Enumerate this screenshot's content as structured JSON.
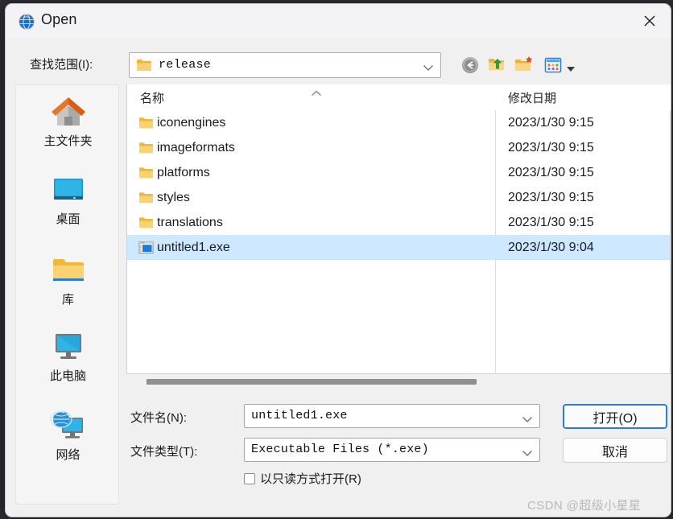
{
  "window": {
    "title": "Open",
    "icon": "qt-globe-icon",
    "close_label": "✕"
  },
  "lookin": {
    "label": "查找范围(I):",
    "value": "release",
    "icon": "folder-icon"
  },
  "toolbar": {
    "back": "back-icon",
    "parent": "parent-folder-icon",
    "new_folder": "new-folder-icon",
    "view_mode": "view-mode-icon",
    "view_arrow": "chevron-down-icon"
  },
  "sidebar": {
    "items": [
      {
        "label": "主文件夹",
        "icon": "home-icon"
      },
      {
        "label": "桌面",
        "icon": "desktop-icon"
      },
      {
        "label": "库",
        "icon": "library-folder-icon"
      },
      {
        "label": "此电脑",
        "icon": "this-pc-icon"
      },
      {
        "label": "网络",
        "icon": "network-icon"
      }
    ]
  },
  "filelist": {
    "columns": [
      "名称",
      "修改日期"
    ],
    "sort_indicator": "sort-ascending-icon",
    "rows": [
      {
        "name": "iconengines",
        "date": "2023/1/30 9:15",
        "icon": "folder-icon",
        "selected": false
      },
      {
        "name": "imageformats",
        "date": "2023/1/30 9:15",
        "icon": "folder-icon",
        "selected": false
      },
      {
        "name": "platforms",
        "date": "2023/1/30 9:15",
        "icon": "folder-icon",
        "selected": false
      },
      {
        "name": "styles",
        "date": "2023/1/30 9:15",
        "icon": "folder-icon",
        "selected": false
      },
      {
        "name": "translations",
        "date": "2023/1/30 9:15",
        "icon": "folder-icon",
        "selected": false
      },
      {
        "name": "untitled1.exe",
        "date": "2023/1/30 9:04",
        "icon": "exe-icon",
        "selected": true
      }
    ]
  },
  "form": {
    "filename_label": "文件名(N):",
    "filename_value": "untitled1.exe",
    "filetype_label": "文件类型(T):",
    "filetype_value": "Executable Files (*.exe)",
    "open_button": "打开(O)",
    "cancel_button": "取消",
    "readonly_label": "以只读方式打开(R)",
    "readonly_checked": false
  },
  "watermark": "CSDN @超级小星星",
  "colors": {
    "selection": "#cde8ff",
    "focus_border": "#2a7fd4",
    "dialog_bg": "#f0f0f0",
    "titlebar_bg": "#f3f3f6",
    "folder_yellow": "#f5c243"
  }
}
